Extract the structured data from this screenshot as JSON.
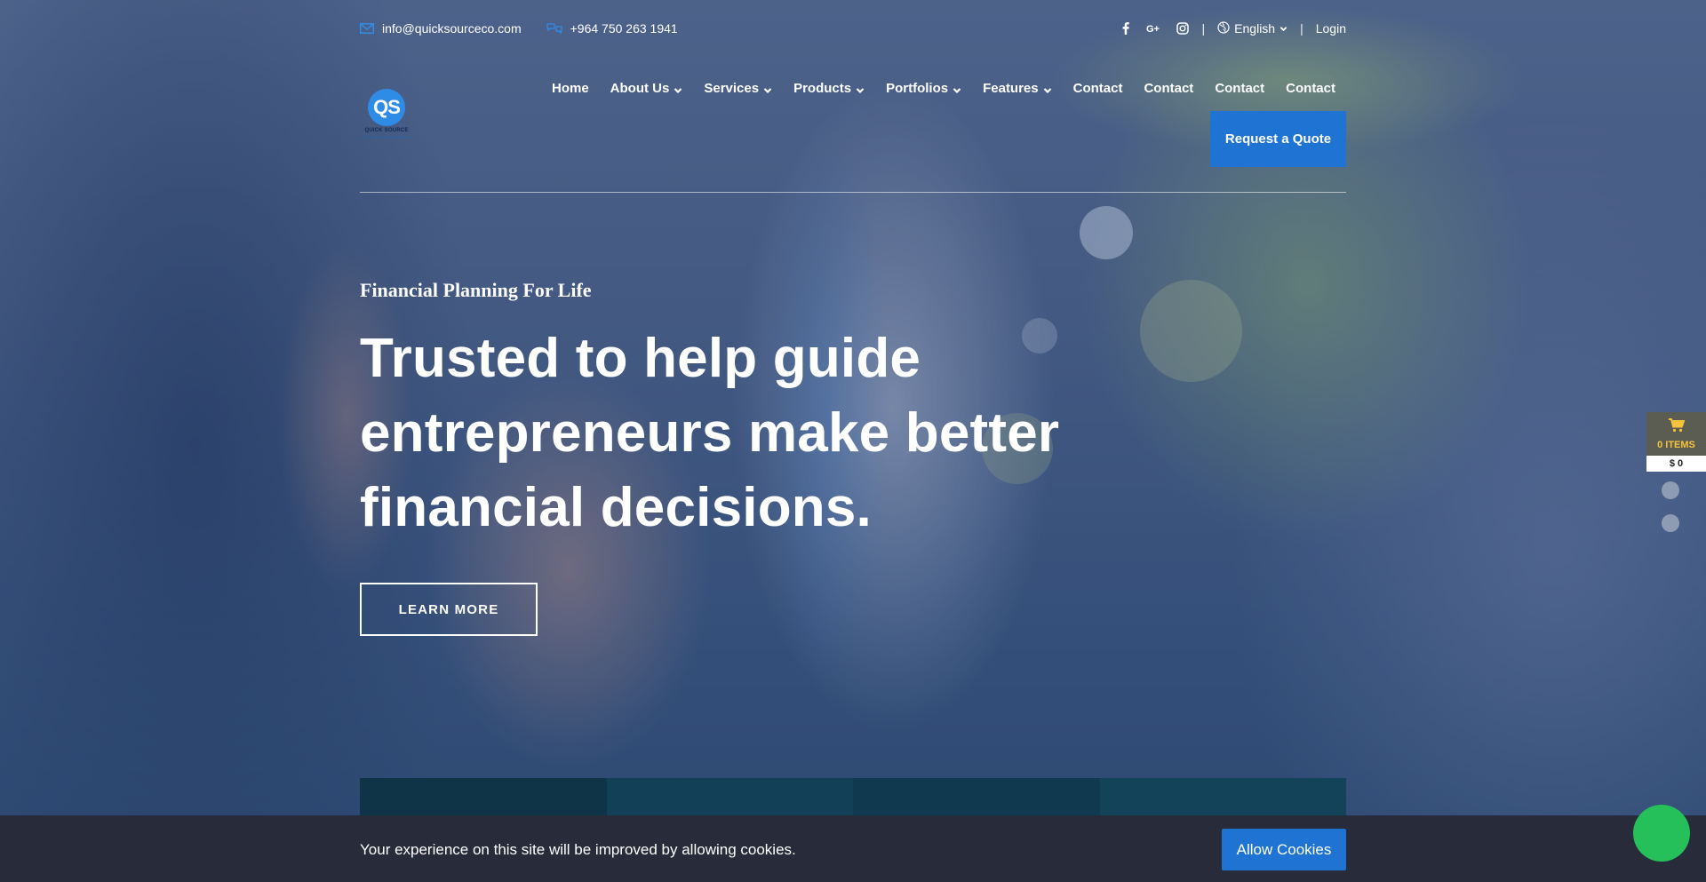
{
  "topbar": {
    "email": "info@quicksourceco.com",
    "phone": "+964 750 263 1941",
    "language": "English",
    "separator": "|",
    "login": "Login",
    "icons": [
      "mail-icon",
      "phone-icon",
      "facebook-icon",
      "google-plus-icon",
      "instagram-icon",
      "globe-icon"
    ]
  },
  "logo": {
    "mark": "QS",
    "line1": "QUICK SOURCE",
    "line2": "SOFTWARE DEVELOPMENT"
  },
  "nav": {
    "items": [
      {
        "label": "Home",
        "dropdown": false
      },
      {
        "label": "About Us",
        "dropdown": true
      },
      {
        "label": "Services",
        "dropdown": true
      },
      {
        "label": "Products",
        "dropdown": true
      },
      {
        "label": "Portfolios",
        "dropdown": true
      },
      {
        "label": "Features",
        "dropdown": true
      },
      {
        "label": "Contact",
        "dropdown": false
      },
      {
        "label": "Contact",
        "dropdown": false
      },
      {
        "label": "Contact",
        "dropdown": false
      },
      {
        "label": "Contact",
        "dropdown": false
      }
    ],
    "quote_button": "Request a Quote"
  },
  "hero": {
    "subtitle": "Financial Planning For Life",
    "headline": "Trusted to help guide entrepreneurs make better financial decisions.",
    "cta": "LEARN MORE"
  },
  "cart": {
    "items": "0 ITEMS",
    "total": "$ 0"
  },
  "cookie": {
    "message": "Your experience on this site will be improved by allowing cookies.",
    "button": "Allow Cookies"
  },
  "colors": {
    "accent": "#1e73d3",
    "cookie_bg": "#272b3a",
    "cart_label": "#f5c33b",
    "whatsapp": "#25c05a"
  }
}
